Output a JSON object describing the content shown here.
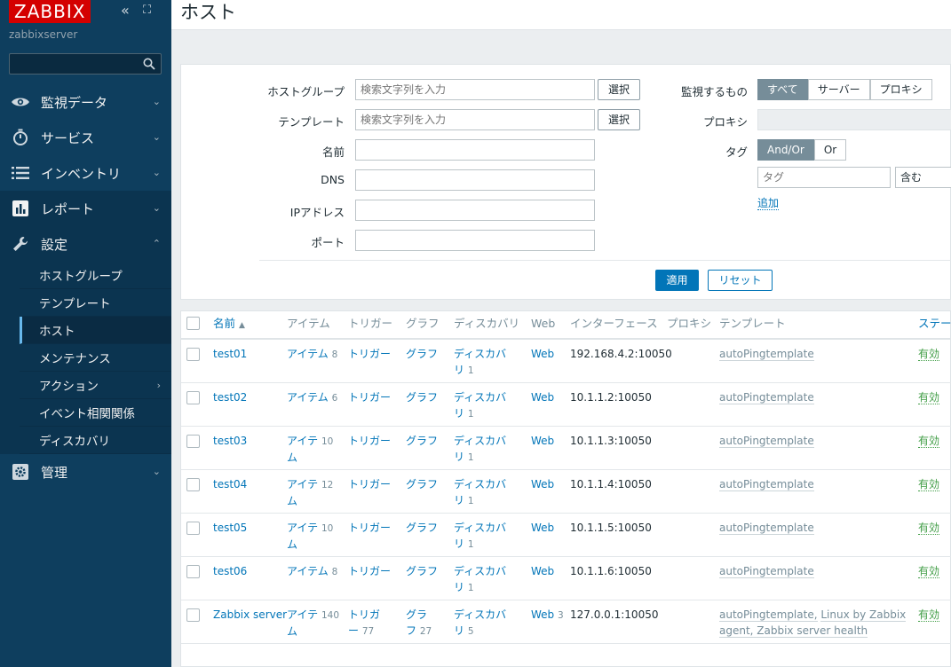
{
  "sidebar": {
    "logo": "ZABBIX",
    "server_name": "zabbixserver",
    "collapse_glyph": "«",
    "expand_glyph": "⛶",
    "search_value": "",
    "menu": [
      {
        "label": "監視データ",
        "icon": "eye-icon"
      },
      {
        "label": "サービス",
        "icon": "timer-icon"
      },
      {
        "label": "インベントリ",
        "icon": "list-icon"
      },
      {
        "label": "レポート",
        "icon": "bar-chart-icon"
      },
      {
        "label": "設定",
        "icon": "wrench-icon"
      }
    ],
    "submenu": [
      {
        "label": "ホストグループ"
      },
      {
        "label": "テンプレート"
      },
      {
        "label": "ホスト"
      },
      {
        "label": "メンテナンス"
      },
      {
        "label": "アクション"
      },
      {
        "label": "イベント相関関係"
      },
      {
        "label": "ディスカバリ"
      }
    ],
    "admin": {
      "label": "管理",
      "icon": "gear-icon"
    }
  },
  "header": {
    "title": "ホスト"
  },
  "filter": {
    "host_group_label": "ホストグループ",
    "host_group_placeholder": "検索文字列を入力",
    "template_label": "テンプレート",
    "template_placeholder": "検索文字列を入力",
    "select_label": "選択",
    "name_label": "名前",
    "dns_label": "DNS",
    "ip_label": "IPアドレス",
    "port_label": "ポート",
    "monitored_by_label": "監視するもの",
    "monitored_by_options": [
      "すべて",
      "サーバー",
      "プロキシ"
    ],
    "proxy_label": "プロキシ",
    "tag_label": "タグ",
    "tag_ops": [
      "And/Or",
      "Or"
    ],
    "tag_placeholder": "タグ",
    "tag_operator": "含む",
    "add_label": "追加",
    "apply_label": "適用",
    "reset_label": "リセット"
  },
  "table": {
    "headers": {
      "name": "名前",
      "name_sort": "▲",
      "items": "アイテム",
      "triggers": "トリガー",
      "graphs": "グラフ",
      "discovery": "ディスカバリ",
      "web": "Web",
      "interface": "インターフェース",
      "proxy": "プロキシ",
      "templates": "テンプレート",
      "status": "ステータス"
    },
    "rows": [
      {
        "name": "test01",
        "items_a": "アイテム",
        "items_b": "",
        "items_count": "8",
        "triggers_a": "トリガー",
        "triggers_b": "",
        "triggers_count": "",
        "graphs_a": "グラフ",
        "graphs_b": "",
        "graphs_count": "",
        "disc_a": "ディスカバ",
        "disc_b": "リ",
        "disc_count": "1",
        "web": "Web",
        "web_count": "",
        "interface": "192.168.4.2:10050",
        "tpl_1": "autoPingtemplate",
        "tpl_2": "",
        "tpl_3": "",
        "status": "有効"
      },
      {
        "name": "test02",
        "items_a": "アイテム",
        "items_b": "",
        "items_count": "6",
        "triggers_a": "トリガー",
        "triggers_b": "",
        "triggers_count": "",
        "graphs_a": "グラフ",
        "graphs_b": "",
        "graphs_count": "",
        "disc_a": "ディスカバ",
        "disc_b": "リ",
        "disc_count": "1",
        "web": "Web",
        "web_count": "",
        "interface": "10.1.1.2:10050",
        "tpl_1": "autoPingtemplate",
        "tpl_2": "",
        "tpl_3": "",
        "status": "有効"
      },
      {
        "name": "test03",
        "items_a": "アイテ",
        "items_b": "ム",
        "items_count": "10",
        "triggers_a": "トリガー",
        "triggers_b": "",
        "triggers_count": "",
        "graphs_a": "グラフ",
        "graphs_b": "",
        "graphs_count": "",
        "disc_a": "ディスカバ",
        "disc_b": "リ",
        "disc_count": "1",
        "web": "Web",
        "web_count": "",
        "interface": "10.1.1.3:10050",
        "tpl_1": "autoPingtemplate",
        "tpl_2": "",
        "tpl_3": "",
        "status": "有効"
      },
      {
        "name": "test04",
        "items_a": "アイテ",
        "items_b": "ム",
        "items_count": "12",
        "triggers_a": "トリガー",
        "triggers_b": "",
        "triggers_count": "",
        "graphs_a": "グラフ",
        "graphs_b": "",
        "graphs_count": "",
        "disc_a": "ディスカバ",
        "disc_b": "リ",
        "disc_count": "1",
        "web": "Web",
        "web_count": "",
        "interface": "10.1.1.4:10050",
        "tpl_1": "autoPingtemplate",
        "tpl_2": "",
        "tpl_3": "",
        "status": "有効"
      },
      {
        "name": "test05",
        "items_a": "アイテ",
        "items_b": "ム",
        "items_count": "10",
        "triggers_a": "トリガー",
        "triggers_b": "",
        "triggers_count": "",
        "graphs_a": "グラフ",
        "graphs_b": "",
        "graphs_count": "",
        "disc_a": "ディスカバ",
        "disc_b": "リ",
        "disc_count": "1",
        "web": "Web",
        "web_count": "",
        "interface": "10.1.1.5:10050",
        "tpl_1": "autoPingtemplate",
        "tpl_2": "",
        "tpl_3": "",
        "status": "有効"
      },
      {
        "name": "test06",
        "items_a": "アイテム",
        "items_b": "",
        "items_count": "8",
        "triggers_a": "トリガー",
        "triggers_b": "",
        "triggers_count": "",
        "graphs_a": "グラフ",
        "graphs_b": "",
        "graphs_count": "",
        "disc_a": "ディスカバ",
        "disc_b": "リ",
        "disc_count": "1",
        "web": "Web",
        "web_count": "",
        "interface": "10.1.1.6:10050",
        "tpl_1": "autoPingtemplate",
        "tpl_2": "",
        "tpl_3": "",
        "status": "有効"
      },
      {
        "name": "Zabbix server",
        "items_a": "アイテ",
        "items_b": "ム",
        "items_count": "140",
        "triggers_a": "トリガ",
        "triggers_b": "ー",
        "triggers_count": "77",
        "graphs_a": "グラ",
        "graphs_b": "フ",
        "graphs_count": "27",
        "disc_a": "ディスカバ",
        "disc_b": "リ",
        "disc_count": "5",
        "web": "Web",
        "web_count": "3",
        "interface": "127.0.0.1:10050",
        "tpl_1": "autoPingtemplate,",
        "tpl_2": "Linux by Zabbix",
        "tpl_3": "agent, Zabbix server health",
        "status": "有効"
      }
    ]
  }
}
